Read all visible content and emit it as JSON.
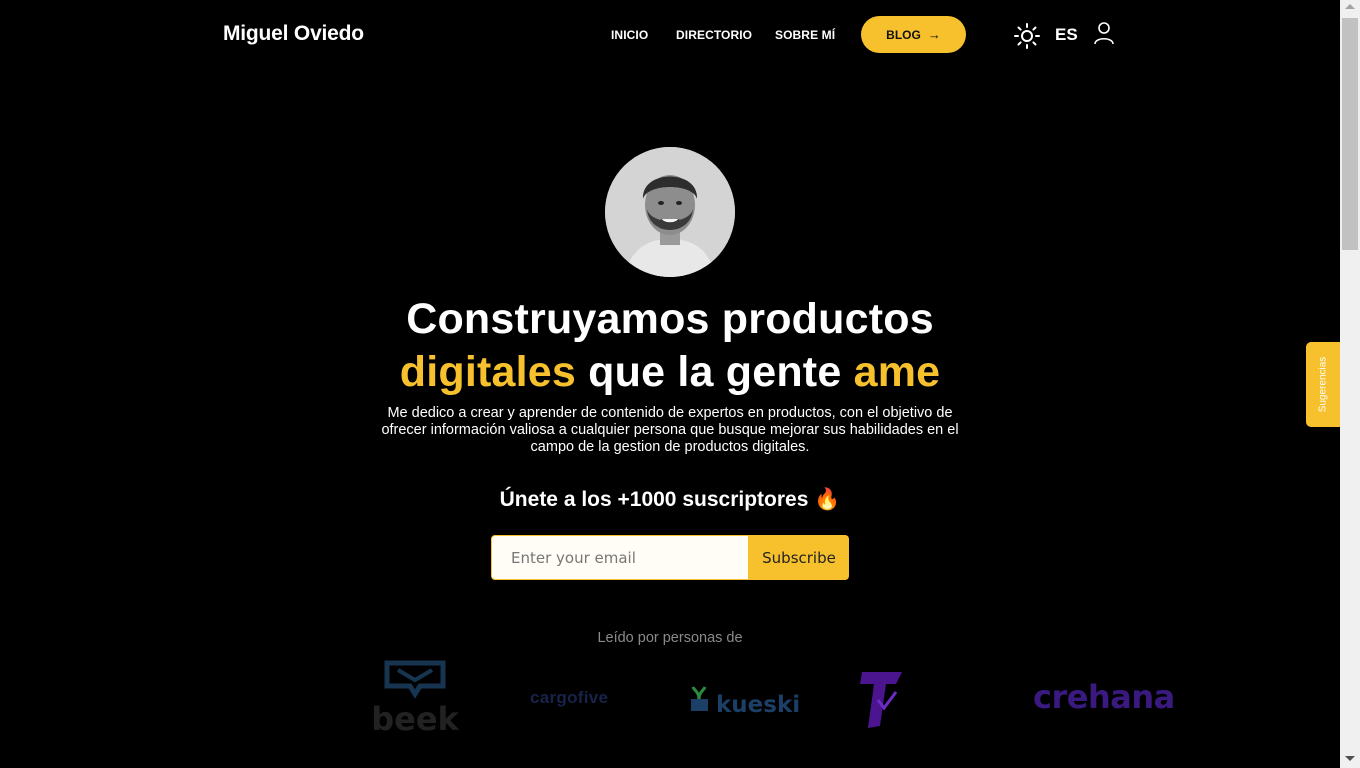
{
  "header": {
    "brand": "Miguel Oviedo",
    "nav": [
      "INICIO",
      "DIRECTORIO",
      "SOBRE MÍ"
    ],
    "blog_label": "BLOG",
    "blog_arrow": "→",
    "lang": "ES",
    "icons": {
      "theme": "sun-icon",
      "user": "user-icon"
    }
  },
  "hero": {
    "line1": "Construyamos productos",
    "line2_accent1": "digitales",
    "line2_mid": " que la gente ",
    "line2_accent2": "ame",
    "description": "Me dedico a crear y aprender de contenido de expertos en productos, con el objetivo de ofrecer información valiosa a cualquier persona que busque mejorar sus habilidades en el campo de la gestion de productos digitales.",
    "subscribe_title": "Únete a los +1000 suscriptores 🔥",
    "email_placeholder": "Enter your email",
    "subscribe_label": "Subscribe",
    "read_by": "Leído por personas de"
  },
  "logos": {
    "beek": "beek",
    "cargofive": "cargofive",
    "kueski": "kueski",
    "crehana": "crehana"
  },
  "side_tab": "Sugerencias",
  "colors": {
    "accent": "#f6c12d",
    "background": "#000000"
  }
}
